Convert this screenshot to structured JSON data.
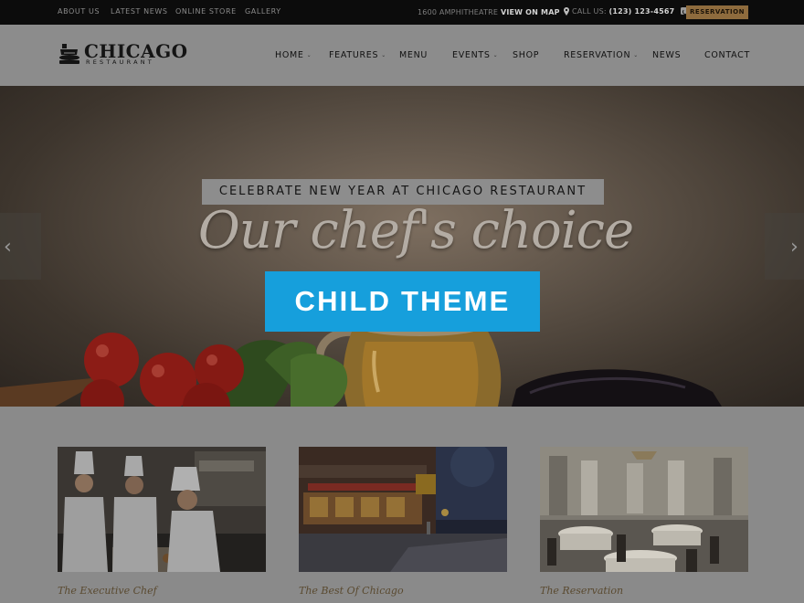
{
  "topbar": {
    "links": [
      "ABOUT US",
      "LATEST NEWS",
      "ONLINE STORE",
      "GALLERY"
    ],
    "address": "1600 AMPHITHEATRE",
    "map_label": "VIEW ON MAP",
    "call_label": "CALL US:",
    "phone": "(123) 123-4567",
    "reservation_button": "RESERVATION"
  },
  "logo": {
    "name": "CHICAGO",
    "subtitle": "RESTAURANT"
  },
  "nav": {
    "items": [
      {
        "label": "HOME",
        "has_dropdown": true
      },
      {
        "label": "FEATURES",
        "has_dropdown": true
      },
      {
        "label": "MENU",
        "has_dropdown": false
      },
      {
        "label": "EVENTS",
        "has_dropdown": true
      },
      {
        "label": "SHOP",
        "has_dropdown": false
      },
      {
        "label": "RESERVATION",
        "has_dropdown": true
      },
      {
        "label": "NEWS",
        "has_dropdown": false
      },
      {
        "label": "CONTACT",
        "has_dropdown": false
      }
    ]
  },
  "hero": {
    "badge": "CELEBRATE NEW YEAR AT CHICAGO RESTAURANT",
    "headline": "Our chef's choice",
    "prev_arrow": "‹",
    "next_arrow": "›"
  },
  "overlay_button": "CHILD THEME",
  "cards": [
    {
      "caption": "The Executive Chef",
      "image": "chefs-in-kitchen"
    },
    {
      "caption": "The Best Of Chicago",
      "image": "restaurant-street-night"
    },
    {
      "caption": "The Reservation",
      "image": "dining-hall"
    }
  ],
  "colors": {
    "topbar_bg": "#0c0c0c",
    "reservation_accent": "#8e6b3d",
    "overlay_button": "#169fdc",
    "caption": "#5a4a30"
  }
}
